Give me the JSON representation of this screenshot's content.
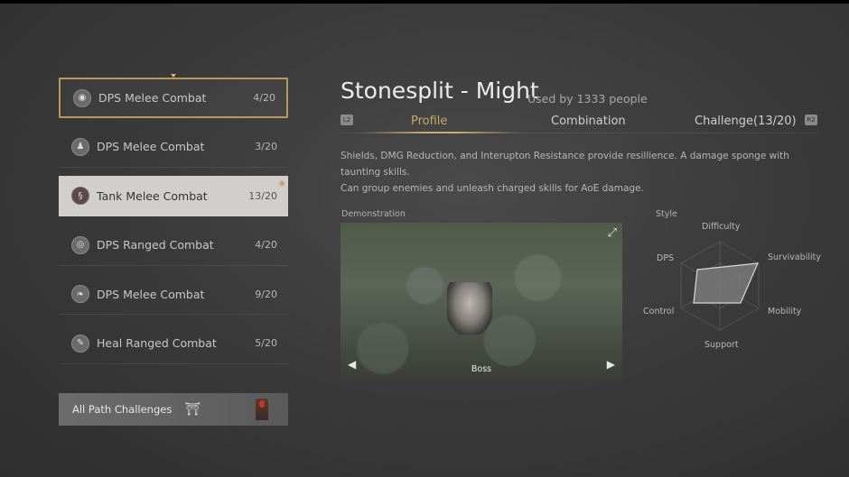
{
  "paths": [
    {
      "name": "DPS Melee Combat",
      "count": "4/20"
    },
    {
      "name": "DPS Melee Combat",
      "count": "3/20"
    },
    {
      "name": "Tank Melee Combat",
      "count": "13/20"
    },
    {
      "name": "DPS Ranged Combat",
      "count": "4/20"
    },
    {
      "name": "DPS Melee Combat",
      "count": "9/20"
    },
    {
      "name": "Heal Ranged Combat",
      "count": "5/20"
    }
  ],
  "all_challenges_label": "All Path Challenges",
  "skill": {
    "title": "Stonesplit - Might",
    "used_by": "Used by 1333 people",
    "description_line1": "Shields, DMG Reduction, and Interupton Resistance provide resillience. A damage sponge with taunting skills.",
    "description_line2": "Can group enemies and unleash charged skills for AoE damage."
  },
  "tabs": {
    "left_button": "L2",
    "right_button": "R2",
    "profile": "Profile",
    "combination": "Combination",
    "challenge": "Challenge(13/20)"
  },
  "demo": {
    "label": "Demonstration",
    "caption": "Boss"
  },
  "style": {
    "label": "Style",
    "axes": {
      "difficulty": "Difficulty",
      "survivability": "Survivability",
      "mobility": "Mobility",
      "support": "Support",
      "control": "Control",
      "dps": "DPS"
    }
  },
  "colors": {
    "accent_gold": "#c9a96a",
    "selected_bg": "#d0cfcd"
  }
}
